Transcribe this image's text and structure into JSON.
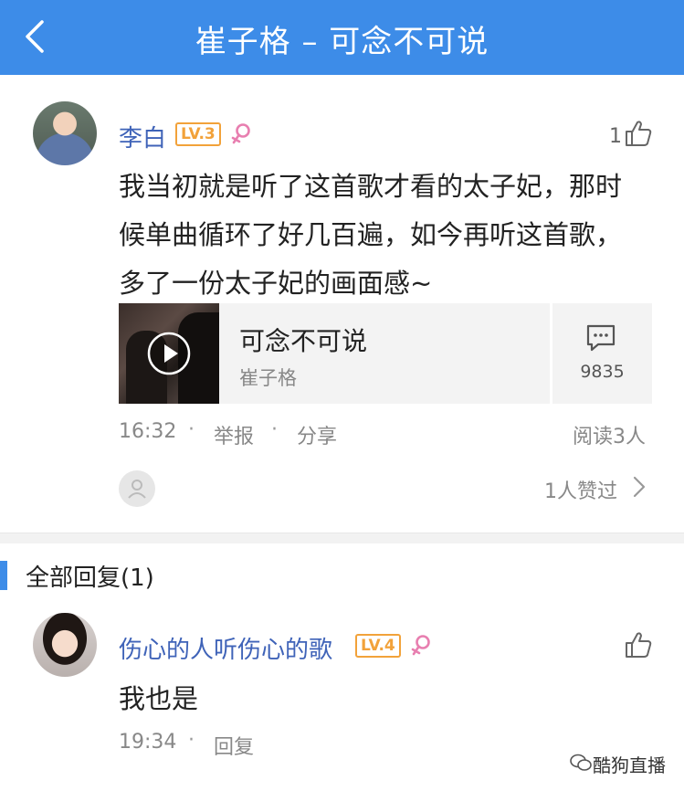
{
  "header": {
    "title": "崔子格 – 可念不可说"
  },
  "main_comment": {
    "username": "李白",
    "level": "LV.3",
    "like_count": "1",
    "text_lines": [
      "我当初就是听了这首歌才看的太子妃，那时",
      "候单曲循环了好几百遍，如今再听这首歌，",
      "多了一份太子妃的画面感~"
    ],
    "song_card": {
      "title": "可念不可说",
      "artist": "崔子格",
      "comment_count": "9835"
    },
    "time": "16:32",
    "report_label": "举报",
    "share_label": "分享",
    "read_count": "阅读3人",
    "liked_by": "1人赞过"
  },
  "replies_section": {
    "title": "全部回复(1)"
  },
  "reply": {
    "username": "伤心的人听伤心的歌",
    "level": "LV.4",
    "text": "我也是",
    "time": "19:34",
    "reply_label": "回复"
  },
  "watermark": "酷狗直播",
  "colors": {
    "header_bg": "#3d8ce8",
    "username": "#3f63b8",
    "badge": "#f2a23a",
    "female": "#e87fb0"
  }
}
